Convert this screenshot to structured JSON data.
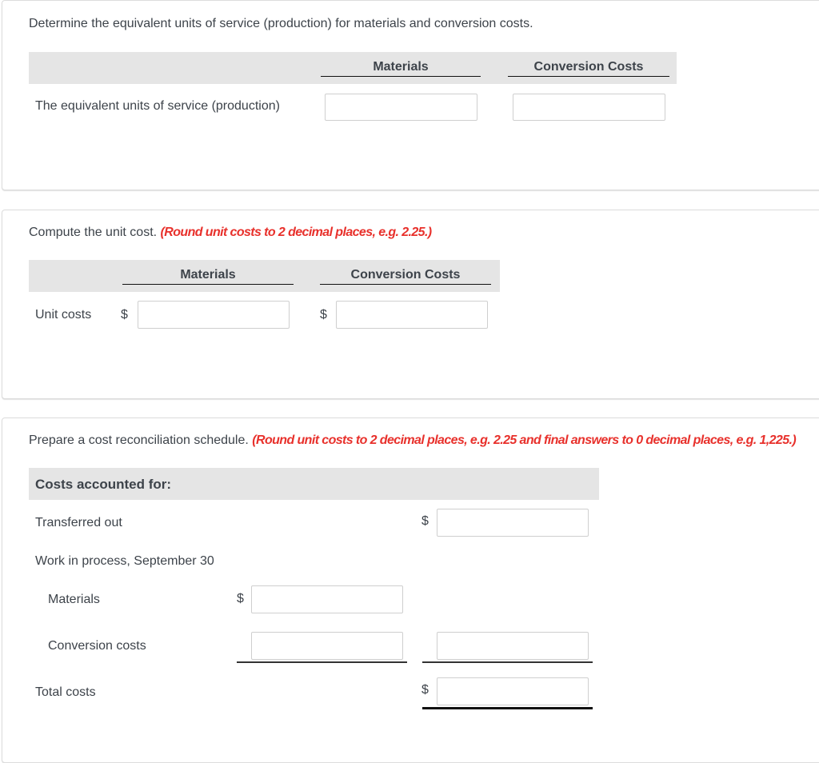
{
  "section1": {
    "prompt": "Determine the equivalent units of service (production) for materials and conversion costs.",
    "columns": [
      "Materials",
      "Conversion Costs"
    ],
    "row_label": "The equivalent units of service (production)",
    "inputs": {
      "materials": "",
      "conversion_costs": ""
    }
  },
  "section2": {
    "prompt": "Compute the unit cost.",
    "hint": "(Round unit costs to 2 decimal places, e.g. 2.25.)",
    "columns": [
      "Materials",
      "Conversion Costs"
    ],
    "row_label": "Unit costs",
    "currency": "$",
    "inputs": {
      "materials": "",
      "conversion_costs": ""
    }
  },
  "section3": {
    "prompt": "Prepare a cost reconciliation schedule.",
    "hint": "(Round unit costs to 2 decimal places, e.g. 2.25 and final answers to 0 decimal places, e.g. 1,225.)",
    "band_label": "Costs accounted for:",
    "currency": "$",
    "rows": {
      "transferred_out": "Transferred out",
      "wip": "Work in process, September 30",
      "materials": "Materials",
      "conversion_costs": "Conversion costs",
      "total_costs": "Total costs"
    },
    "inputs": {
      "transferred_out": "",
      "wip_materials": "",
      "wip_conversion_costs": "",
      "wip_total": "",
      "total_costs": ""
    }
  }
}
